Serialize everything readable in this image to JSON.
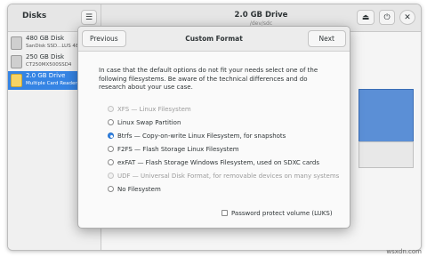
{
  "sidebar": {
    "title": "Disks",
    "disks": [
      {
        "name": "480 GB Disk",
        "model": "SanDisk SSD...LUS 48"
      },
      {
        "name": "250 GB Disk",
        "model": "CT250MX500SSD4"
      },
      {
        "name": "2.0 GB Drive",
        "model": "Multiple Card  Reader",
        "selected": true
      }
    ]
  },
  "header": {
    "menu_icon": "hamburger-menu-icon",
    "drive_title": "2.0 GB Drive",
    "drive_subtitle": "/dev/sdc",
    "eject_icon": "eject-icon",
    "power_icon": "power-icon",
    "close_icon": "close-icon"
  },
  "dialog": {
    "previous_label": "Previous",
    "title": "Custom Format",
    "next_label": "Next",
    "intro": "In case that the default options do not fit your needs select one of the following filesystems. Be aware of the technical differences and do research about your use case.",
    "options": [
      {
        "label": "XFS — Linux Filesystem",
        "disabled": true,
        "selected": false
      },
      {
        "label": "Linux Swap Partition",
        "disabled": false,
        "selected": false
      },
      {
        "label": "Btrfs — Copy-on-write Linux Filesystem, for snapshots",
        "disabled": false,
        "selected": true
      },
      {
        "label": "F2FS — Flash Storage Linux Filesystem",
        "disabled": false,
        "selected": false
      },
      {
        "label": "exFAT — Flash Storage Windows Filesystem, used on SDXC cards",
        "disabled": false,
        "selected": false
      },
      {
        "label": "UDF — Universal Disk Format, for removable devices on many systems",
        "disabled": true,
        "selected": false
      },
      {
        "label": "No Filesystem",
        "disabled": false,
        "selected": false
      }
    ],
    "password_label": "Password protect volume (LUKS)",
    "password_checked": false
  },
  "watermark": "wsxdn.com",
  "colors": {
    "accent": "#3584e4",
    "partition": "#5b8fd6"
  }
}
